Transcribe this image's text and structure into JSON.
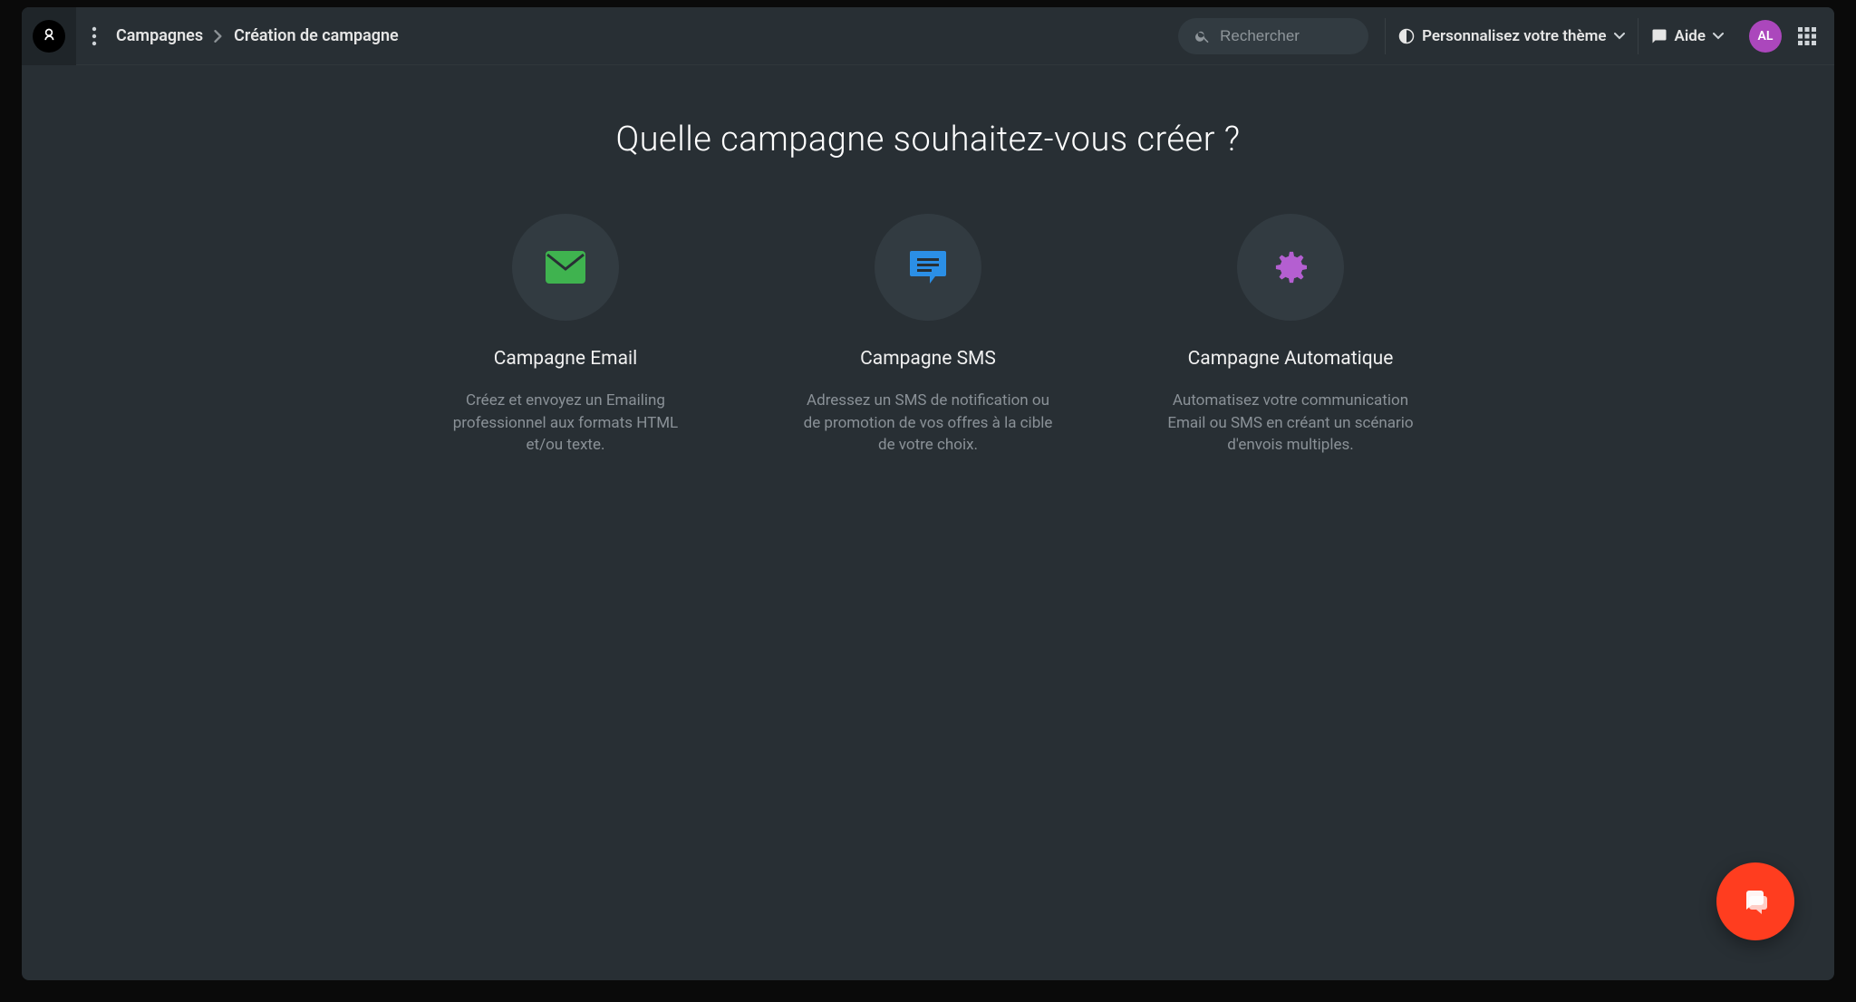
{
  "header": {
    "breadcrumb": {
      "root": "Campagnes",
      "current": "Création de campagne"
    },
    "search_placeholder": "Rechercher",
    "theme_label": "Personnalisez votre thème",
    "help_label": "Aide",
    "avatar_initials": "AL"
  },
  "main": {
    "title": "Quelle campagne souhaitez-vous créer ?",
    "options": [
      {
        "icon": "email",
        "title": "Campagne Email",
        "desc": "Créez et envoyez un Emailing professionnel aux formats HTML et/ou texte.",
        "color": "#3fb34f"
      },
      {
        "icon": "sms",
        "title": "Campagne SMS",
        "desc": "Adressez un SMS de notification ou de promotion de vos offres à la cible de votre choix.",
        "color": "#2b8fe6"
      },
      {
        "icon": "gear",
        "title": "Campagne Automatique",
        "desc": "Automatisez votre communication Email ou SMS en créant un scénario d'envois multiples.",
        "color": "#b45fd1"
      }
    ]
  },
  "colors": {
    "accent_email": "#3fb34f",
    "accent_sms": "#2b8fe6",
    "accent_auto": "#b45fd1",
    "fab": "#ff3d1f"
  }
}
